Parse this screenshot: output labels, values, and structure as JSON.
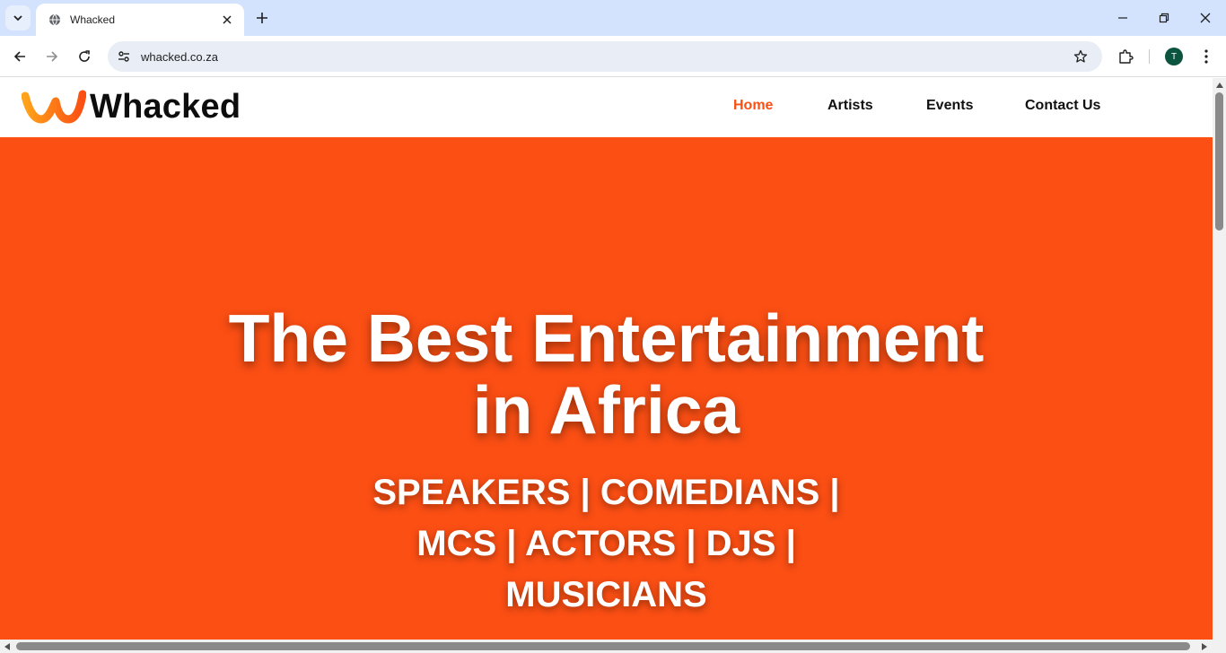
{
  "browser": {
    "tab_title": "Whacked",
    "url": "whacked.co.za",
    "profile_initial": "T"
  },
  "site": {
    "logo_text": "Whacked",
    "nav": [
      {
        "label": "Home",
        "active": true
      },
      {
        "label": "Artists",
        "active": false
      },
      {
        "label": "Events",
        "active": false
      },
      {
        "label": "Contact Us",
        "active": false
      }
    ]
  },
  "hero": {
    "title_line1": "The Best Entertainment",
    "title_line2": "in Africa",
    "sub_line1": "SPEAKERS | COMEDIANS |",
    "sub_line2": "MCS | ACTORS | DJS |",
    "sub_line3": "MUSICIANS"
  },
  "colors": {
    "brand_orange": "#fb4f14",
    "tabstrip": "#d3e3fd",
    "avatar": "#0b5540"
  },
  "icons": [
    "tab-search-icon",
    "globe-icon",
    "close-icon",
    "plus-icon",
    "minimize-icon",
    "restore-icon",
    "back-icon",
    "forward-icon",
    "reload-icon",
    "site-settings-icon",
    "star-icon",
    "extensions-icon",
    "more-vert-icon"
  ]
}
